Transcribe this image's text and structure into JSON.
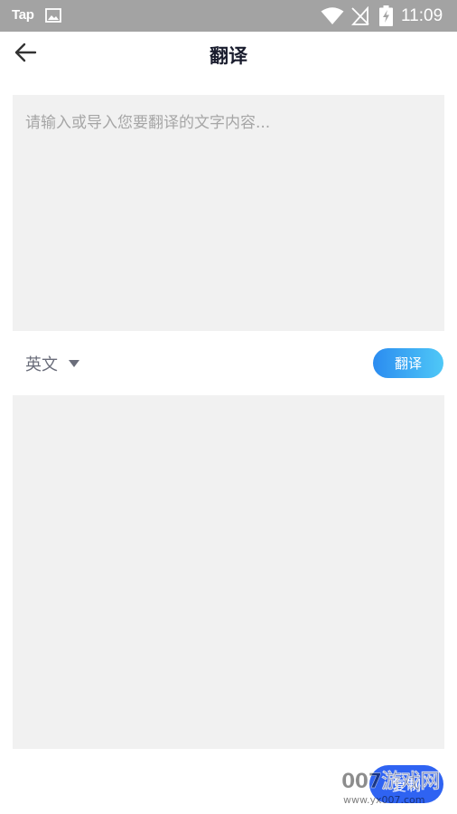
{
  "status_bar": {
    "app_label": "Tap",
    "time": "11:09",
    "icons": [
      "image-icon",
      "wifi-icon",
      "no-signal-icon",
      "battery-charging-icon"
    ],
    "background": "#a3a3a3"
  },
  "header": {
    "title": "翻译",
    "back_icon": "arrow-left-icon"
  },
  "input": {
    "placeholder": "请输入或导入您要翻译的文字内容...",
    "value": ""
  },
  "language": {
    "selected": "英文",
    "caret_icon": "caret-down-icon"
  },
  "translate_button": {
    "label": "翻译",
    "gradient": [
      "#2b8cf0",
      "#4fc8f7"
    ]
  },
  "output": {
    "text": ""
  },
  "floating_button": {
    "label": "复制",
    "color": "#2f63f2"
  },
  "watermark": {
    "text": "007游戏网",
    "url": "www.yx007.com"
  }
}
